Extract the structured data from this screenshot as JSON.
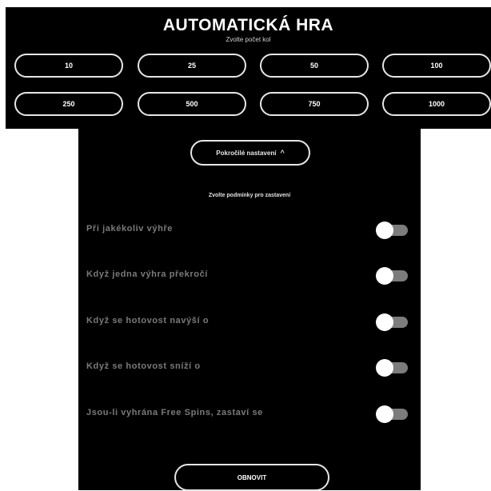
{
  "header": {
    "title": "AUTOMATICKÁ HRA",
    "subtitle": "Zvolte počet kol"
  },
  "rounds": {
    "options": [
      {
        "label": "10"
      },
      {
        "label": "25"
      },
      {
        "label": "50"
      },
      {
        "label": "100"
      },
      {
        "label": "250"
      },
      {
        "label": "500"
      },
      {
        "label": "750"
      },
      {
        "label": "1000"
      }
    ]
  },
  "advanced": {
    "label": "Pokročilé nastavení",
    "chevron": "^",
    "icon": "chevron-up-icon"
  },
  "conditions": {
    "heading": "Zvolte podmínky pro zastavení",
    "items": [
      {
        "label": "Při jakékoliv výhře",
        "enabled": false
      },
      {
        "label": "Když jedna výhra překročí",
        "enabled": false
      },
      {
        "label": "Když se hotovost navýší o",
        "enabled": false
      },
      {
        "label": "Když se hotovost sníží o",
        "enabled": false
      },
      {
        "label": "Jsou-li vyhrána Free Spins, zastaví se",
        "enabled": false
      }
    ]
  },
  "footer": {
    "reset_label": "OBNOVIT"
  },
  "colors": {
    "background": "#000000",
    "border": "#e6e6e6",
    "toggle_track": "#7c7c7c",
    "toggle_knob": "#ffffff",
    "label_muted": "#7a7a7a"
  }
}
